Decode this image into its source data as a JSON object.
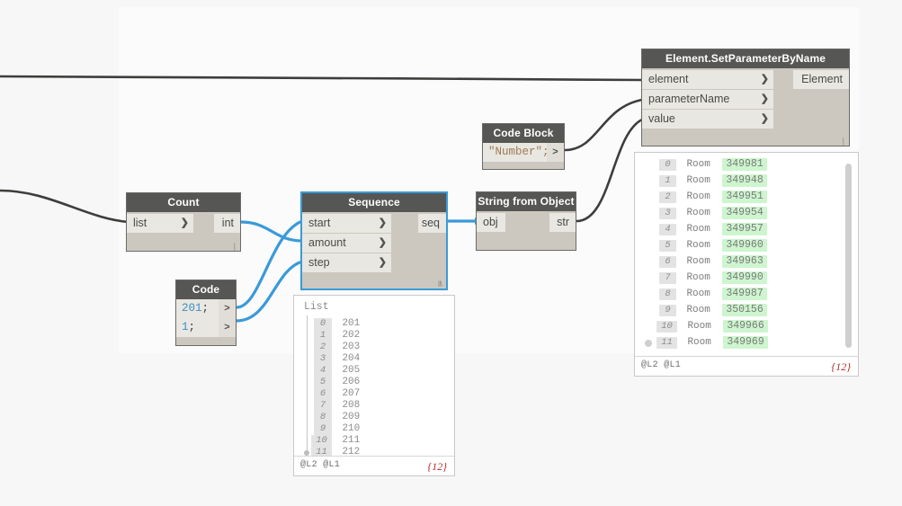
{
  "canvas": {
    "background": "#f7f7f7",
    "region_background": "#fbfbfb"
  },
  "colors": {
    "node_header": "#565654",
    "node_body": "#ccc8bf",
    "port": "#e9e7e1",
    "selected_border": "#3a9ad9",
    "wire_data": "#3a9ad9",
    "wire_object": "#3d3d3b",
    "value_highlight": "#cdf5ce",
    "count_badge": "#b03030",
    "code_number": "#3b8ec4",
    "code_string": "#9b7b56"
  },
  "nodes": {
    "set_parameter": {
      "title": "Element.SetParameterByName",
      "inputs": [
        "element",
        "parameterName",
        "value"
      ],
      "outputs": [
        "Element"
      ]
    },
    "code_block_number": {
      "title": "Code Block",
      "lines": [
        {
          "text": "\"Number\";",
          "type": "string"
        }
      ],
      "out_symbol": ">"
    },
    "count": {
      "title": "Count",
      "inputs": [
        "list"
      ],
      "outputs": [
        "int"
      ]
    },
    "code_block_seq": {
      "title": "Code Block",
      "lines": [
        {
          "text": "201;",
          "number": "201",
          "punct": ";",
          "type": "number"
        },
        {
          "text": "1;",
          "number": "1",
          "punct": ";",
          "type": "number"
        }
      ],
      "out_symbol": ">"
    },
    "sequence": {
      "title": "Sequence",
      "inputs": [
        "start",
        "amount",
        "step"
      ],
      "outputs": [
        "seq"
      ],
      "selected": true
    },
    "string_from_object": {
      "title": "String from Object",
      "inputs": [
        "obj"
      ],
      "outputs": [
        "str"
      ]
    }
  },
  "previews": {
    "sequence_preview": {
      "title": "List",
      "indices": [
        "0",
        "1",
        "2",
        "3",
        "4",
        "5",
        "6",
        "7",
        "8",
        "9",
        "10",
        "11"
      ],
      "values": [
        "201",
        "202",
        "203",
        "204",
        "205",
        "206",
        "207",
        "208",
        "209",
        "210",
        "211",
        "212"
      ],
      "footer_levels": "@L2 @L1",
      "footer_count": "{12}"
    },
    "set_parameter_preview": {
      "indices": [
        "0",
        "1",
        "2",
        "3",
        "4",
        "5",
        "6",
        "7",
        "8",
        "9",
        "10",
        "11"
      ],
      "labels": [
        "Room",
        "Room",
        "Room",
        "Room",
        "Room",
        "Room",
        "Room",
        "Room",
        "Room",
        "Room",
        "Room",
        "Room"
      ],
      "values": [
        "349981",
        "349948",
        "349951",
        "349954",
        "349957",
        "349960",
        "349963",
        "349990",
        "349987",
        "350156",
        "349966",
        "349969"
      ],
      "footer_levels": "@L2 @L1",
      "footer_count": "{12}"
    }
  },
  "icons": {
    "chevron_right": "❯",
    "resize_grip": "‖\\"
  }
}
